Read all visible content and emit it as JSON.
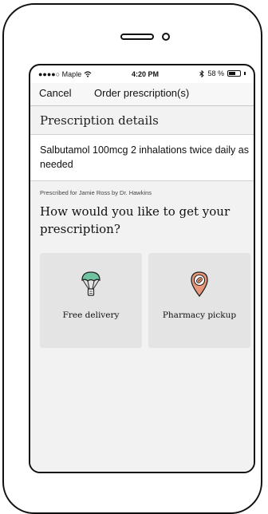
{
  "status": {
    "carrier": "●●●●○ Maple",
    "time": "4:20 PM",
    "battery": "58 %",
    "battery_level": 0.58,
    "wifi_icon": "wifi-icon",
    "bluetooth_icon": "bluetooth-icon"
  },
  "nav": {
    "cancel": "Cancel",
    "title": "Order prescription(s)"
  },
  "details": {
    "heading": "Prescription details",
    "medication": "Salbutamol 100mcg 2 inhalations twice daily as needed",
    "prescribed_by": "Prescribed for Jamie Ross by Dr. Hawkins"
  },
  "question": "How would you like to get your prescription?",
  "options": [
    {
      "label": "Free delivery",
      "icon": "parachute-delivery-icon",
      "accent": "#6fc3a0"
    },
    {
      "label": "Pharmacy pickup",
      "icon": "map-pin-pill-icon",
      "accent": "#e9967a"
    }
  ]
}
